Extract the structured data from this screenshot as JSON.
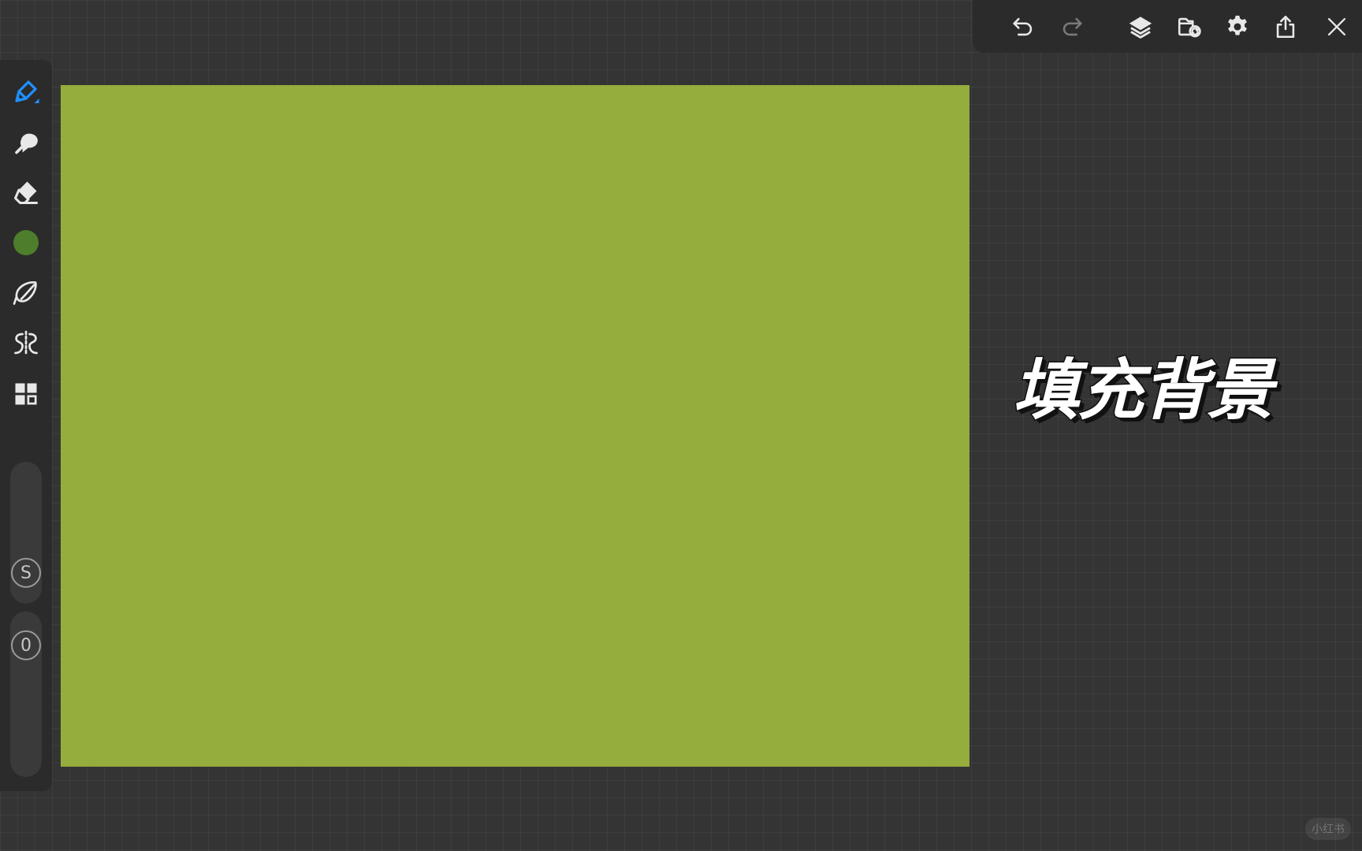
{
  "top_toolbar": {
    "buttons": [
      {
        "name": "undo",
        "icon": "undo-icon"
      },
      {
        "name": "redo",
        "icon": "redo-icon"
      },
      {
        "name": "layers",
        "icon": "layers-icon"
      },
      {
        "name": "gallery-import",
        "icon": "folder-sync-icon"
      },
      {
        "name": "settings",
        "icon": "gear-icon"
      },
      {
        "name": "export",
        "icon": "share-icon"
      },
      {
        "name": "close",
        "icon": "close-icon"
      }
    ]
  },
  "left_toolbar": {
    "tools": [
      {
        "name": "pen",
        "icon": "pen-icon",
        "active": true
      },
      {
        "name": "smudge",
        "icon": "smudge-icon"
      },
      {
        "name": "eraser",
        "icon": "eraser-icon"
      },
      {
        "name": "color",
        "icon": "color-swatch-icon"
      },
      {
        "name": "lasso",
        "icon": "lasso-icon"
      },
      {
        "name": "symmetry",
        "icon": "symmetry-icon"
      },
      {
        "name": "layout",
        "icon": "grid-layout-icon"
      }
    ],
    "size_slider_label": "S",
    "opacity_slider_label": "0"
  },
  "colors": {
    "accent": "#1e90ff",
    "current_color": "#4e7d2b",
    "canvas_fill": "#95ad3d",
    "background": "#343434",
    "toolbar": "#2b2b2b",
    "icon": "#e8e8e8"
  },
  "caption": "填充背景",
  "watermark": "小红书"
}
